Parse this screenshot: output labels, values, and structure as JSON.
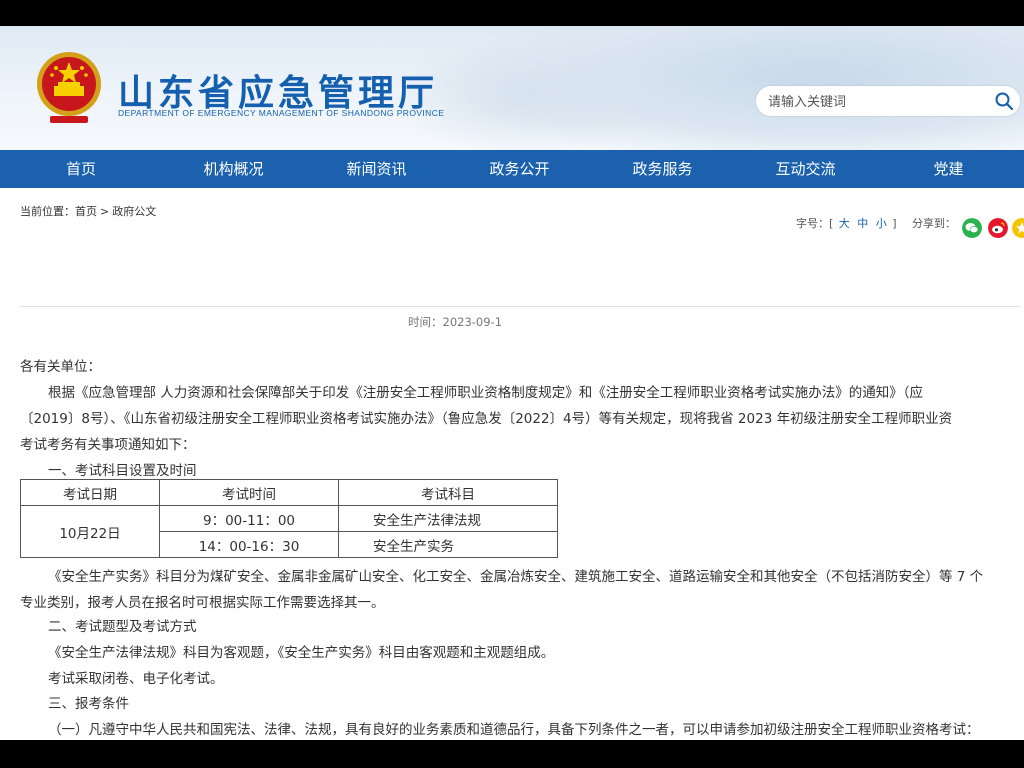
{
  "header": {
    "site_title": "山东省应急管理厅",
    "site_subtitle": "DEPARTMENT OF EMERGENCY MANAGEMENT OF SHANDONG PROVINCE",
    "search_placeholder": "请输入关键词"
  },
  "nav": [
    "首页",
    "机构概况",
    "新闻资讯",
    "政务公开",
    "政务服务",
    "互动交流",
    "党建"
  ],
  "breadcrumb": {
    "prefix": "当前位置：",
    "home": "首页",
    "sep": ">",
    "current": "政府公文"
  },
  "toolbar": {
    "fontsize_label": "字号：[",
    "fontsize_options": [
      "大",
      "中",
      "小"
    ],
    "fontsize_close": "]",
    "share_label": "分享到："
  },
  "meta": {
    "time": "时间：2023-09-1"
  },
  "doc": {
    "salutation": "各有关单位：",
    "para1_line1": "根据《应急管理部 人力资源和社会保障部关于印发《注册安全工程师职业资格制度规定》和《注册安全工程师职业资格考试实施办法》的通知》（应",
    "para1_line2": "〔2019〕8号）、《山东省初级注册安全工程师职业资格考试实施办法》（鲁应急发〔2022〕4号）等有关规定，现将我省 2023 年初级注册安全工程师职业资",
    "para1_line3": "考试考务有关事项通知如下：",
    "section1": "一、考试科目设置及时间",
    "table_headers": [
      "考试日期",
      "考试时间",
      "考试科目"
    ],
    "table_date": "10月22日",
    "table_rows": [
      {
        "time": "9：00-11：00",
        "subject": "安全生产法律法规"
      },
      {
        "time": "14：00-16：30",
        "subject": "安全生产实务"
      }
    ],
    "para2_line1": "《安全生产实务》科目分为煤矿安全、金属非金属矿山安全、化工安全、金属冶炼安全、建筑施工安全、道路运输安全和其他安全（不包括消防安全）等 7 个",
    "para2_line2": "专业类别，报考人员在报名时可根据实际工作需要选择其一。",
    "section2": "二、考试题型及考试方式",
    "para3": "《安全生产法律法规》科目为客观题，《安全生产实务》科目由客观题和主观题组成。",
    "para4": "考试采取闭卷、电子化考试。",
    "section3": "三、报考条件",
    "para5": "（一）凡遵守中华人民共和国宪法、法律、法规，具有良好的业务素质和道德品行，具备下列条件之一者，可以申请参加初级注册安全工程师职业资格考试："
  },
  "colors": {
    "brand": "#1560ae",
    "nav_bg": "#1b61ad",
    "wechat": "#2bb24c",
    "weibo": "#e6162d",
    "qzone": "#f5c400"
  },
  "icons": [
    "national-emblem-icon",
    "search-icon",
    "wechat-icon",
    "weibo-icon",
    "qzone-icon"
  ]
}
